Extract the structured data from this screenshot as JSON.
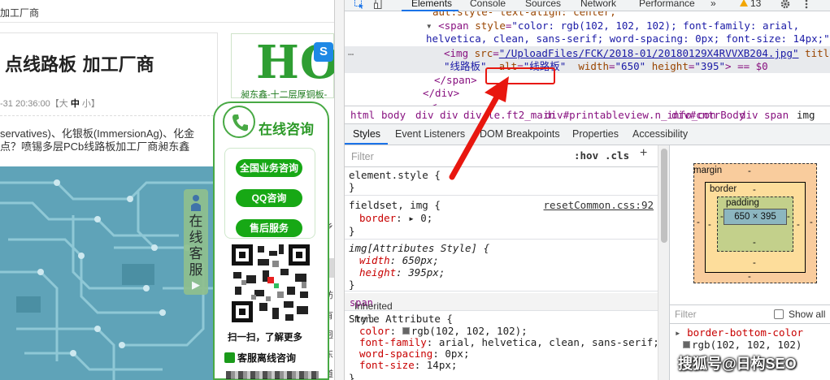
{
  "webpage": {
    "breadcrumb": "加工厂商",
    "article_title": "点线路板 加工厂商",
    "meta_date": "-31 20:36:00【大",
    "meta_mid": "中",
    "meta_small": "小】",
    "line1": "servatives)、化银板(ImmersionAg)、化金",
    "line2": "点？喷锡多层PCb线路板加工厂商昶东鑫",
    "ad_text": "HO",
    "ad_caption": "昶东鑫-十二层厚铜板-",
    "float_badge": "S",
    "kefu_label": "在线客服",
    "kefu_arrow": "▶",
    "side_chars": [
      "乡",
      "纺",
      "有",
      "迥",
      "东",
      "道"
    ],
    "consult": {
      "title": "在线咨询",
      "buttons": [
        "全国业务咨询",
        "QQ咨询",
        "售后服务"
      ],
      "scan_text": "扫一扫，了解更多",
      "offline_text": "客服离线咨询"
    }
  },
  "devtools": {
    "tabs": [
      "Elements",
      "Console",
      "Sources",
      "Network",
      "Performance"
    ],
    "more_tabs": "»",
    "warning_count": "13",
    "dom": {
      "line0": "aut:style-  text-align: center;",
      "span_tag": "<span",
      "span_style_attr": "style",
      "span_style_val_1": "\"color: rgb(102, 102, 102); font-family: arial,",
      "span_style_val_2": "helvetica, clean, sans-serif; word-spacing: 0px; font-size: 14px;\"",
      "span_close": ">",
      "img_tag": "<img",
      "img_src_attr": "src",
      "img_src_val": "\"/UploadFiles/FCK/2018-01/20180129X4RVVXB204.jpg\"",
      "img_title_attr": "title",
      "img_title_val": "\"线路板\"",
      "img_alt_attr": "alt",
      "img_alt_val": "\"线路板\"",
      "img_width_attr": "width",
      "img_width_val": "\"650\"",
      "img_height_attr": "height",
      "img_height_val": "\"395\"",
      "img_end": "> == $0",
      "span_end": "</span>",
      "div_end": "</div>",
      "cut_line": "<..."
    },
    "crumbs": [
      "html",
      "body",
      "div",
      "div",
      "div.le.ft2_main",
      "div#printableview.n_info_con",
      "div#cntrBody",
      "div",
      "span",
      "img"
    ],
    "subtabs": [
      "Styles",
      "Event Listeners",
      "DOM Breakpoints",
      "Properties",
      "Accessibility"
    ],
    "styles": {
      "filter_placeholder": "Filter",
      "hov": ":hov",
      "cls": ".cls",
      "plus": "+",
      "element_style": "element.style {",
      "close": "}",
      "fieldset_sel": "fieldset, img {",
      "fieldset_src": "resetCommon.css:92",
      "border_prop": "border",
      "border_val": ": ▸ 0;",
      "attr_sel": "img[Attributes Style] {",
      "width_prop": "width",
      "width_val": ": 650px;",
      "height_prop": "height",
      "height_val": ": 395px;",
      "inherited_label": "Inherited from",
      "inherited_from": "span",
      "style_attr_sel": "Style Attribute {",
      "color_prop": "color",
      "color_val": "rgb(102, 102, 102);",
      "ff_prop": "font-family",
      "ff_val": ": arial, helvetica, clean, sans-serif;",
      "ws_prop": "word-spacing",
      "ws_val": ": 0px;",
      "fs_prop": "font-size",
      "fs_val": ": 14px;"
    },
    "boxmodel": {
      "margin_label": "margin",
      "border_label": "border",
      "padding_label": "padding",
      "content": "650 × 395",
      "dash": "-"
    },
    "computed": {
      "filter_placeholder": "Filter",
      "show_all": "Show all",
      "prop": "border-bottom-color",
      "val": "rgb(102, 102, 102)"
    }
  },
  "watermark": "搜狐号@日构SEO",
  "colors": {
    "accent": "#1a73e8",
    "annotation_red": "#e8170f",
    "consult_green": "#48a944"
  }
}
